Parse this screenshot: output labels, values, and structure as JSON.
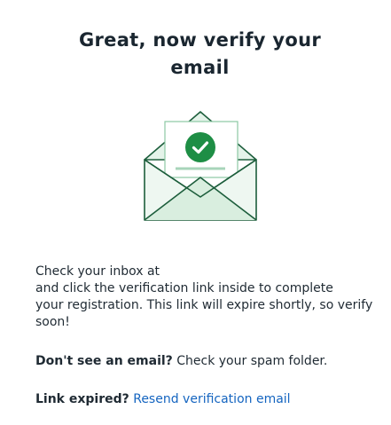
{
  "heading": {
    "line1": "Great, now verify your",
    "line2": "email"
  },
  "illustration": {
    "icon": "envelope-with-checkmark-icon",
    "colors": {
      "envelope_fill": "#e4f3e9",
      "envelope_stroke": "#1d5e3c",
      "check_circle": "#1e8e45",
      "letter_line": "#a8d5ba"
    }
  },
  "instructions": {
    "line1": "Check your inbox at",
    "line2": "and click the verification link inside to complete",
    "line3": "your registration. This link will expire shortly, so verify",
    "line4": "soon!"
  },
  "spam_notice": {
    "bold": "Don't see an email?",
    "text": "Check your spam folder."
  },
  "expired_notice": {
    "bold": "Link expired?",
    "link_label": "Resend verification email"
  },
  "colors": {
    "text": "#1f2a33",
    "link": "#1565c0"
  }
}
